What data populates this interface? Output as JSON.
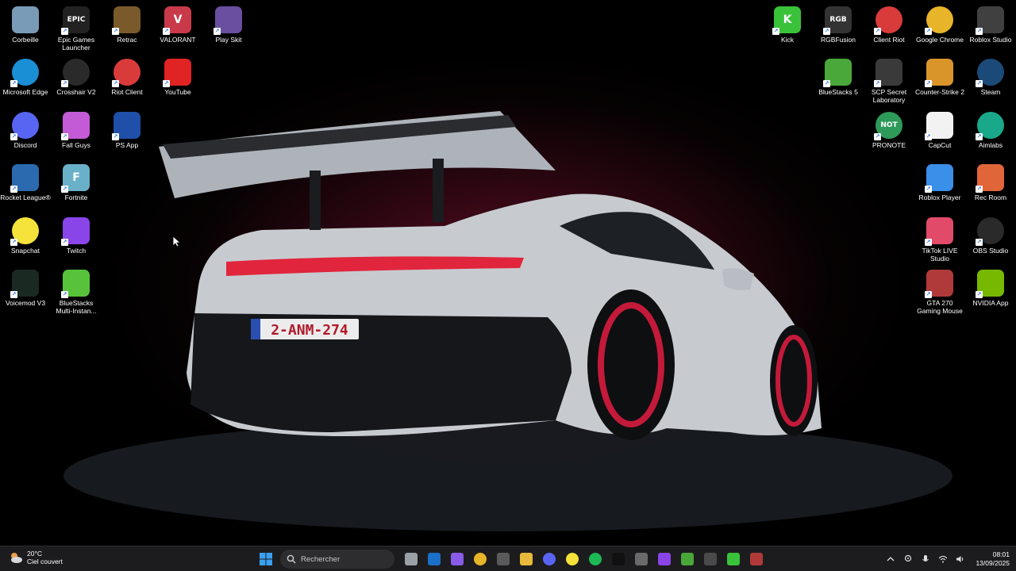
{
  "desktop": {
    "icons": [
      {
        "label": "Corbeille",
        "icon": "recycle-bin-icon",
        "color": "#7a9bb8"
      },
      {
        "label": "Epic Games Launcher",
        "icon": "epic-games-icon",
        "color": "#222222",
        "text": "EPIC"
      },
      {
        "label": "Retrac",
        "icon": "retrac-icon",
        "color": "#7a5a2a"
      },
      {
        "label": "VALORANT",
        "icon": "valorant-icon",
        "color": "#c83a4a",
        "text": "V"
      },
      {
        "label": "Play Skit",
        "icon": "play-skit-icon",
        "color": "#6a4fa0"
      },
      {
        "label": "Microsoft Edge",
        "icon": "edge-icon",
        "color": "#1a8fd6"
      },
      {
        "label": "Crosshair V2",
        "icon": "crosshair-icon",
        "color": "#2a2a2a"
      },
      {
        "label": "Riot Client",
        "icon": "riot-client-icon",
        "color": "#d93b3b"
      },
      {
        "label": "YouTube",
        "icon": "youtube-icon",
        "color": "#e02424"
      },
      {
        "label": "Discord",
        "icon": "discord-icon",
        "color": "#5865f2"
      },
      {
        "label": "Fall Guys",
        "icon": "fall-guys-icon",
        "color": "#c45bd6"
      },
      {
        "label": "PS App",
        "icon": "playstation-icon",
        "color": "#1f4fa8"
      },
      {
        "label": "Rocket League®",
        "icon": "rocket-league-icon",
        "color": "#2c6ab0"
      },
      {
        "label": "Fortnite",
        "icon": "fortnite-icon",
        "color": "#6ab0c8",
        "text": "F"
      },
      {
        "label": "Snapchat",
        "icon": "snapchat-icon",
        "color": "#f5e23a"
      },
      {
        "label": "Twitch",
        "icon": "twitch-icon",
        "color": "#8a45e8"
      },
      {
        "label": "Voicemod V3",
        "icon": "voicemod-icon",
        "color": "#1a2a22"
      },
      {
        "label": "BlueStacks Multi-Instan...",
        "icon": "bluestacks-multi-icon",
        "color": "#58c23a"
      },
      {
        "label": "Kick",
        "icon": "kick-icon",
        "color": "#3ac23a",
        "text": "K"
      },
      {
        "label": "RGBFusion",
        "icon": "rgb-fusion-icon",
        "color": "#333333",
        "text": "RGB"
      },
      {
        "label": "Client Riot",
        "icon": "riot-client-icon",
        "color": "#d93b3b"
      },
      {
        "label": "Google Chrome",
        "icon": "chrome-icon",
        "color": "#e8b52a"
      },
      {
        "label": "Roblox Studio",
        "icon": "roblox-studio-icon",
        "color": "#404040"
      },
      {
        "label": "BlueStacks 5",
        "icon": "bluestacks-icon",
        "color": "#4aa83a"
      },
      {
        "label": "SCP Secret Laboratory",
        "icon": "scp-icon",
        "color": "#3a3a3a"
      },
      {
        "label": "Counter-Strike 2",
        "icon": "counter-strike-icon",
        "color": "#d9952a"
      },
      {
        "label": "Steam",
        "icon": "steam-icon",
        "color": "#1b4a78"
      },
      {
        "label": "PRONOTE",
        "icon": "pronote-icon",
        "color": "#2e9a5a",
        "text": "NOT"
      },
      {
        "label": "CapCut",
        "icon": "capcut-icon",
        "color": "#f2f2f2"
      },
      {
        "label": "Aimlabs",
        "icon": "aimlabs-icon",
        "color": "#1aa88a"
      },
      {
        "label": "Roblox Player",
        "icon": "roblox-player-icon",
        "color": "#3a8fe8"
      },
      {
        "label": "Rec Room",
        "icon": "rec-room-icon",
        "color": "#e0663a"
      },
      {
        "label": "TikTok LIVE Studio",
        "icon": "tiktok-live-icon",
        "color": "#e24a6a"
      },
      {
        "label": "OBS Studio",
        "icon": "obs-icon",
        "color": "#2a2a2a"
      },
      {
        "label": "GTA 270 Gaming Mouse",
        "icon": "gta-mouse-icon",
        "color": "#b03a3a"
      },
      {
        "label": "NVIDIA App",
        "icon": "nvidia-icon",
        "color": "#76b900"
      }
    ]
  },
  "taskbar": {
    "weather": {
      "temp": "20°C",
      "desc": "Ciel couvert"
    },
    "search_placeholder": "Rechercher",
    "apps": [
      {
        "icon": "task-view-icon",
        "color": "#9aa0a6"
      },
      {
        "icon": "outlook-icon",
        "color": "#1a6fc8"
      },
      {
        "icon": "copilot-icon",
        "color": "#8a5ae8"
      },
      {
        "icon": "chrome-icon",
        "color": "#e8b52a"
      },
      {
        "icon": "microsoft-store-icon",
        "color": "#5a5a5a"
      },
      {
        "icon": "file-explorer-icon",
        "color": "#e8b93a"
      },
      {
        "icon": "discord-icon",
        "color": "#5865f2"
      },
      {
        "icon": "snapchat-icon",
        "color": "#f5e23a"
      },
      {
        "icon": "spotify-icon",
        "color": "#1db954"
      },
      {
        "icon": "tiktok-icon",
        "color": "#111111"
      },
      {
        "icon": "settings-icon",
        "color": "#6a6a6a"
      },
      {
        "icon": "twitch-icon",
        "color": "#8a45e8"
      },
      {
        "icon": "bluestacks-icon",
        "color": "#4aa83a"
      },
      {
        "icon": "chrome-dev-icon",
        "color": "#4a4a4a"
      },
      {
        "icon": "kick-icon",
        "color": "#3ac23a"
      },
      {
        "icon": "gta-mouse-icon",
        "color": "#b03a3a"
      }
    ],
    "clock": {
      "time": "08:01",
      "date": "13/09/2025"
    }
  }
}
